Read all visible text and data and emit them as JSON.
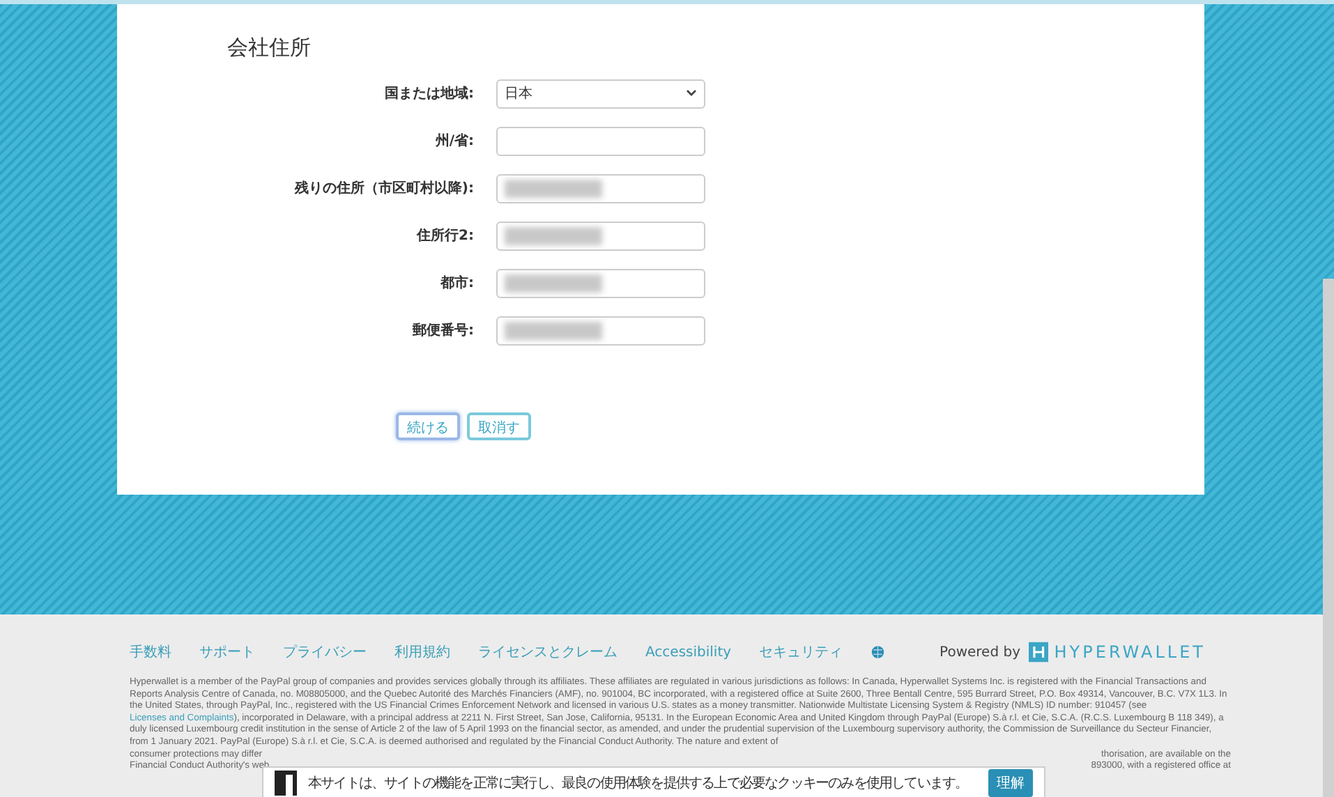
{
  "form": {
    "title": "会社住所",
    "fields": [
      {
        "kind": "select",
        "label": "国または地域:",
        "value": "日本",
        "redacted": false
      },
      {
        "kind": "input",
        "label": "州/省:",
        "redacted": false
      },
      {
        "kind": "input",
        "label": "残りの住所（市区町村以降):",
        "redacted": true
      },
      {
        "kind": "input",
        "label": "住所行2:",
        "redacted": true
      },
      {
        "kind": "input",
        "label": "都市:",
        "redacted": true
      },
      {
        "kind": "input",
        "label": "郵便番号:",
        "redacted": true
      }
    ],
    "buttons": [
      {
        "label": "続ける",
        "focused": true
      },
      {
        "label": "取消す",
        "focused": false
      }
    ]
  },
  "footer": {
    "links": [
      "手数料",
      "サポート",
      "プライバシー",
      "利用規約",
      "ライセンスとクレーム",
      "Accessibility",
      "セキュリティ"
    ],
    "powered_by": "Powered by",
    "brand": "HYPERWALLET",
    "legal": "Hyperwallet is a member of the PayPal group of companies and provides services globally through its affiliates. These affiliates are regulated in various jurisdictions as follows: In Canada, Hyperwallet Systems Inc. is registered with the Financial Transactions and Reports Analysis Centre of Canada, no. M08805000, and the Quebec Autorité des Marchés Financiers (AMF), no. 901004, BC incorporated, with a registered office at Suite 2600, Three Bentall Centre, 595 Burrard Street, P.O. Box 49314, Vancouver, B.C. V7X 1L3. In the United States, through PayPal, Inc., registered with the US Financial Crimes Enforcement Network and licensed in various U.S. states as a money transmitter. Nationwide Multistate Licensing System & Registry (NMLS) ID number: 910457 (see",
    "legal_link": "Licenses and Complaints",
    "legal_rest": "), incorporated in Delaware, with a principal address at 2211 N. First Street, San Jose, California, 95131. In the European Economic Area and United Kingdom through PayPal (Europe) S.à r.l. et Cie, S.C.A. (R.C.S. Luxembourg B 118 349), a duly licensed Luxembourg credit institution in the sense of Article 2 of the law of 5 April 1993 on the financial sector, as amended, and under the prudential supervision of the Luxembourg supervisory authority, the Commission de Surveillance du Secteur Financier, from 1 January 2021. PayPal (Europe) S.à r.l. et Cie, S.C.A. is deemed authorised and regulated by the Financial Conduct Authority. The nature and extent of",
    "legal_left": [
      "consumer protections may differ",
      "Financial Conduct Authority's web"
    ],
    "legal_right": [
      "thorisation, are available on the",
      "893000, with a registered office at"
    ]
  },
  "cookie_banner": {
    "text": "本サイトは、サイトの機能を正常に実行し、最良の使用体験を提供する上で必要なクッキーのみを使用しています。",
    "button": "理解"
  }
}
